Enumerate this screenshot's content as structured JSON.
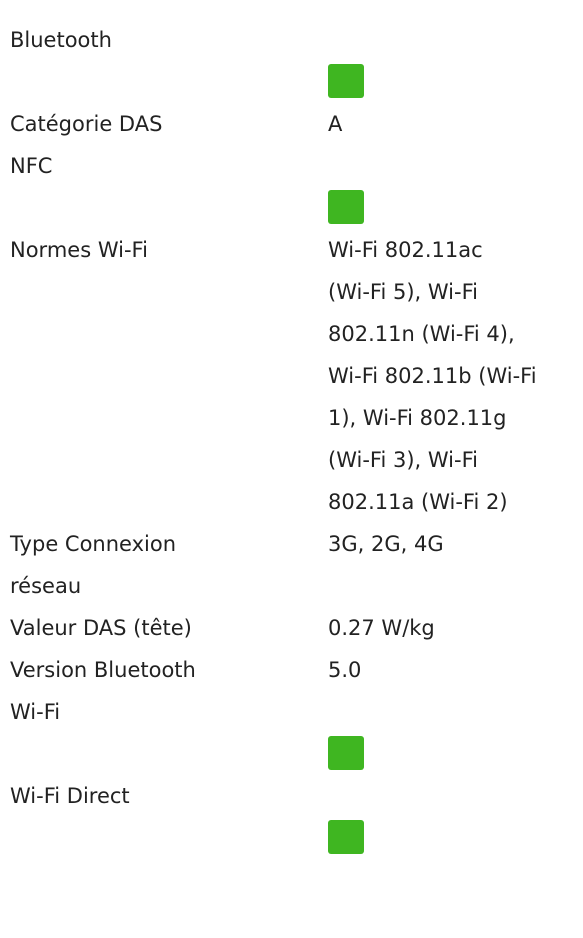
{
  "specs": [
    {
      "label": "Bluetooth",
      "check": true,
      "value": ""
    },
    {
      "label": "Catégorie DAS",
      "check": false,
      "value": "A"
    },
    {
      "label": "NFC",
      "check": true,
      "value": ""
    },
    {
      "label": "Normes Wi-Fi",
      "check": false,
      "value": "Wi-Fi 802.11ac\n(Wi-Fi 5), Wi-Fi\n802.11n (Wi-Fi 4),\nWi-Fi 802.11b (Wi-Fi\n1), Wi-Fi 802.11g\n(Wi-Fi 3), Wi-Fi\n802.11a (Wi-Fi 2)"
    },
    {
      "label": "Type Connexion\nréseau",
      "check": false,
      "value": "3G, 2G, 4G"
    },
    {
      "label": "Valeur DAS (tête)",
      "check": false,
      "value": "0.27 W/kg"
    },
    {
      "label": "Version Bluetooth",
      "check": false,
      "value": "5.0"
    },
    {
      "label": "Wi-Fi",
      "check": true,
      "value": ""
    },
    {
      "label": "Wi-Fi Direct",
      "check": true,
      "value": ""
    }
  ],
  "colors": {
    "check_bg": "#3fb621",
    "text": "#222222"
  },
  "icons": {
    "check": "checkmark-icon"
  }
}
